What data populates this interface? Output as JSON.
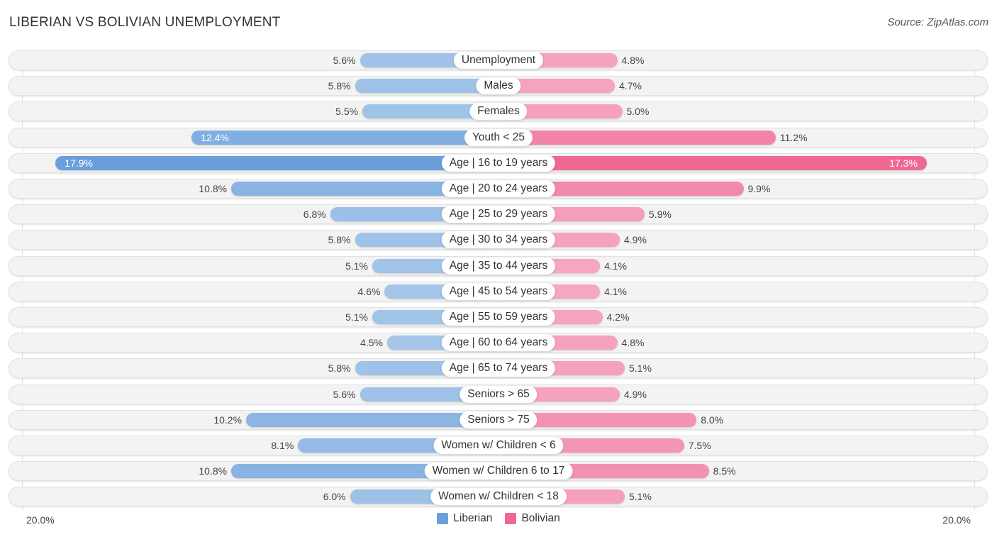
{
  "header": {
    "title": "LIBERIAN VS BOLIVIAN UNEMPLOYMENT",
    "source": "Source: ZipAtlas.com"
  },
  "chart_data": {
    "type": "bar",
    "orientation": "horizontal-diverging",
    "title": "LIBERIAN VS BOLIVIAN UNEMPLOYMENT",
    "xlabel": "",
    "ylabel": "",
    "xlim": [
      -20,
      20
    ],
    "axis_labels": {
      "left": "20.0%",
      "right": "20.0%"
    },
    "legend_position": "bottom-center",
    "categories": [
      "Unemployment",
      "Males",
      "Females",
      "Youth < 25",
      "Age | 16 to 19 years",
      "Age | 20 to 24 years",
      "Age | 25 to 29 years",
      "Age | 30 to 34 years",
      "Age | 35 to 44 years",
      "Age | 45 to 54 years",
      "Age | 55 to 59 years",
      "Age | 60 to 64 years",
      "Age | 65 to 74 years",
      "Seniors > 65",
      "Seniors > 75",
      "Women w/ Children < 6",
      "Women w/ Children 6 to 17",
      "Women w/ Children < 18"
    ],
    "series": [
      {
        "name": "Liberian",
        "color": "#6a9fdc",
        "light_color": "#a7c7ea",
        "side": "left",
        "values": [
          5.6,
          5.8,
          5.5,
          12.4,
          17.9,
          10.8,
          6.8,
          5.8,
          5.1,
          4.6,
          5.1,
          4.5,
          5.8,
          5.6,
          10.2,
          8.1,
          10.8,
          6.0
        ],
        "labels": [
          "5.6%",
          "5.8%",
          "5.5%",
          "12.4%",
          "17.9%",
          "10.8%",
          "6.8%",
          "5.8%",
          "5.1%",
          "4.6%",
          "5.1%",
          "4.5%",
          "5.8%",
          "5.6%",
          "10.2%",
          "8.1%",
          "10.8%",
          "6.0%"
        ]
      },
      {
        "name": "Bolivian",
        "color": "#f06892",
        "light_color": "#f6a6bf",
        "side": "right",
        "values": [
          4.8,
          4.7,
          5.0,
          11.2,
          17.3,
          9.9,
          5.9,
          4.9,
          4.1,
          4.1,
          4.2,
          4.8,
          5.1,
          4.9,
          8.0,
          7.5,
          8.5,
          5.1
        ],
        "labels": [
          "4.8%",
          "4.7%",
          "5.0%",
          "11.2%",
          "17.3%",
          "9.9%",
          "5.9%",
          "4.9%",
          "4.1%",
          "4.1%",
          "4.2%",
          "4.8%",
          "5.1%",
          "4.9%",
          "8.0%",
          "7.5%",
          "8.5%",
          "5.1%"
        ]
      }
    ]
  },
  "legend": {
    "items": [
      {
        "label": "Liberian",
        "color": "#6a9fdc"
      },
      {
        "label": "Bolivian",
        "color": "#f06892"
      }
    ]
  }
}
